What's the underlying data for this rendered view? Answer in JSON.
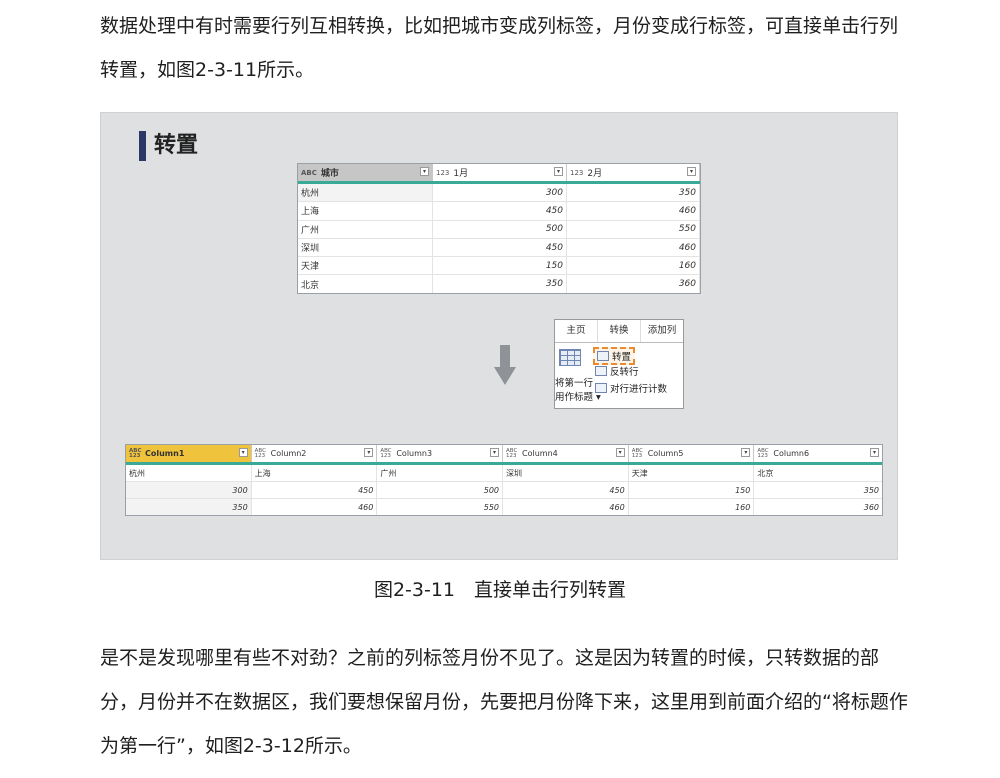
{
  "intro": "数据处理中有时需要行列互相转换，比如把城市变成列标签，月份变成行标签，可直接单击行列转置，如图2-3-11所示。",
  "figure": {
    "title": "转置",
    "table1": {
      "headers": [
        {
          "type": "ABC",
          "label": "城市"
        },
        {
          "type": "123",
          "label": "1月"
        },
        {
          "type": "123",
          "label": "2月"
        }
      ],
      "rows": [
        [
          "杭州",
          "300",
          "350"
        ],
        [
          "上海",
          "450",
          "460"
        ],
        [
          "广州",
          "500",
          "550"
        ],
        [
          "深圳",
          "450",
          "460"
        ],
        [
          "天津",
          "150",
          "160"
        ],
        [
          "北京",
          "350",
          "360"
        ]
      ]
    },
    "ribbon": {
      "tabs": [
        "主页",
        "转换",
        "添加列"
      ],
      "left_line1": "将第一行",
      "left_line2": "用作标题 ▾",
      "items": [
        "转置",
        "反转行",
        "对行进行计数"
      ]
    },
    "table2": {
      "headers": [
        "Column1",
        "Column2",
        "Column3",
        "Column4",
        "Column5",
        "Column6"
      ],
      "header_type": "ABC 123",
      "rows": [
        [
          "杭州",
          "上海",
          "广州",
          "深圳",
          "天津",
          "北京"
        ],
        [
          "300",
          "450",
          "500",
          "450",
          "150",
          "350"
        ],
        [
          "350",
          "460",
          "550",
          "460",
          "160",
          "360"
        ]
      ]
    }
  },
  "caption": "图2-3-11　直接单击行列转置",
  "after": "是不是发现哪里有些不对劲？之前的列标签月份不见了。这是因为转置的时候，只转数据的部分，月份并不在数据区，我们要想保留月份，先要把月份降下来，这里用到前面介绍的“将标题作为第一行”，如图2-3-12所示。",
  "colors": {
    "accent_teal": "#3aaa98",
    "title_bar": "#2b3866",
    "selected_header": "#f0c33c",
    "highlight": "#e98b2e"
  }
}
